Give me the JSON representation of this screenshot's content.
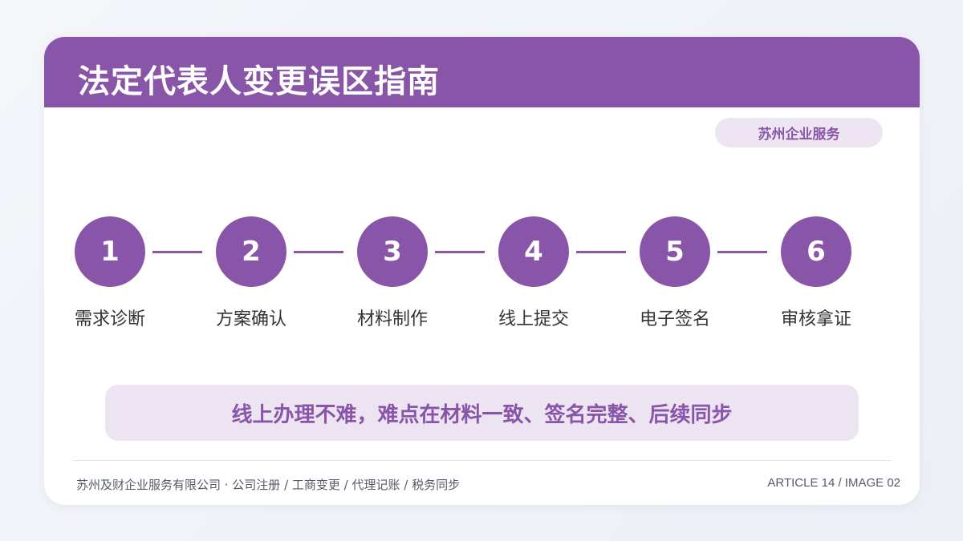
{
  "title": "法定代表人变更误区指南",
  "badge": "苏州企业服务",
  "steps": [
    {
      "number": "1",
      "label": "需求诊断"
    },
    {
      "number": "2",
      "label": "方案确认"
    },
    {
      "number": "3",
      "label": "材料制作"
    },
    {
      "number": "4",
      "label": "线上提交"
    },
    {
      "number": "5",
      "label": "电子签名"
    },
    {
      "number": "6",
      "label": "审核拿证"
    }
  ],
  "tip": "线上办理不难，难点在材料一致、签名完整、后续同步",
  "footer": {
    "company": "苏州及财企业服务有限公司 · 公司注册 / 工商变更 / 代理记账 / 税务同步",
    "article": "ARTICLE 14 / IMAGE 02"
  },
  "colors": {
    "accent": "#8855a8",
    "accent_light": "#ece5f1",
    "background": "#eef1f7",
    "card": "#ffffff"
  }
}
